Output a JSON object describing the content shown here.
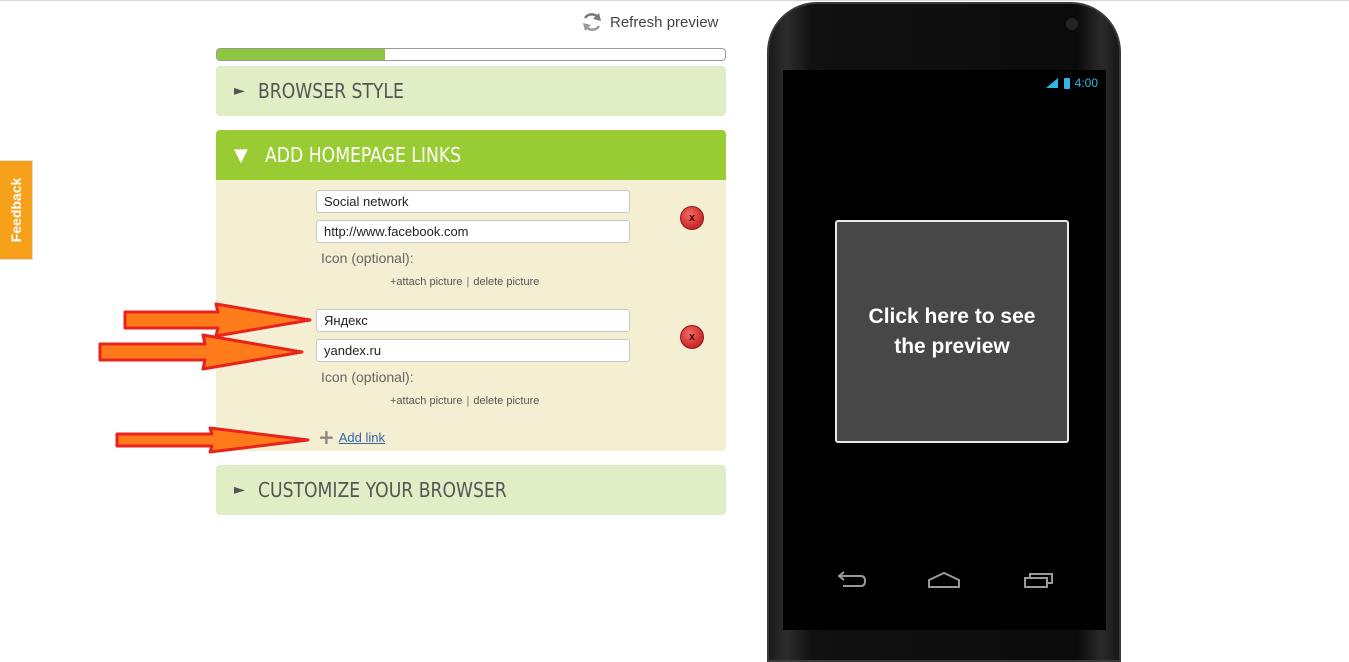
{
  "toolbar": {
    "refresh_label": "Refresh preview"
  },
  "feedback_label": "Feedback",
  "progress": {
    "percent": 33,
    "color": "#8dc63f"
  },
  "sections": {
    "browser_style": {
      "title": "BROWSER STYLE"
    },
    "homepage_links": {
      "title": "ADD HOMEPAGE LINKS",
      "links": [
        {
          "name": "Social network",
          "url": "http://www.facebook.com"
        },
        {
          "name": "Яндекс",
          "url": "yandex.ru"
        }
      ],
      "icon_label": "Icon (optional):",
      "attach_label": "+attach picture",
      "separator": "|",
      "delete_picture_label": "delete picture",
      "delete_button_glyph": "x",
      "add_link_label": "Add link"
    },
    "customize": {
      "title": "CUSTOMIZE YOUR BROWSER"
    }
  },
  "phone": {
    "status_time": "4:00",
    "preview_text": "Click here to see the preview",
    "nav_icons": [
      "back-icon",
      "home-icon",
      "recent-apps-icon"
    ]
  },
  "colors": {
    "accent_green": "#99cc33",
    "panel_light": "#e0edc5",
    "panel_body": "#f4eed2",
    "feedback_orange": "#f7a11a",
    "annotation_arrow": "#ff7a1a"
  }
}
